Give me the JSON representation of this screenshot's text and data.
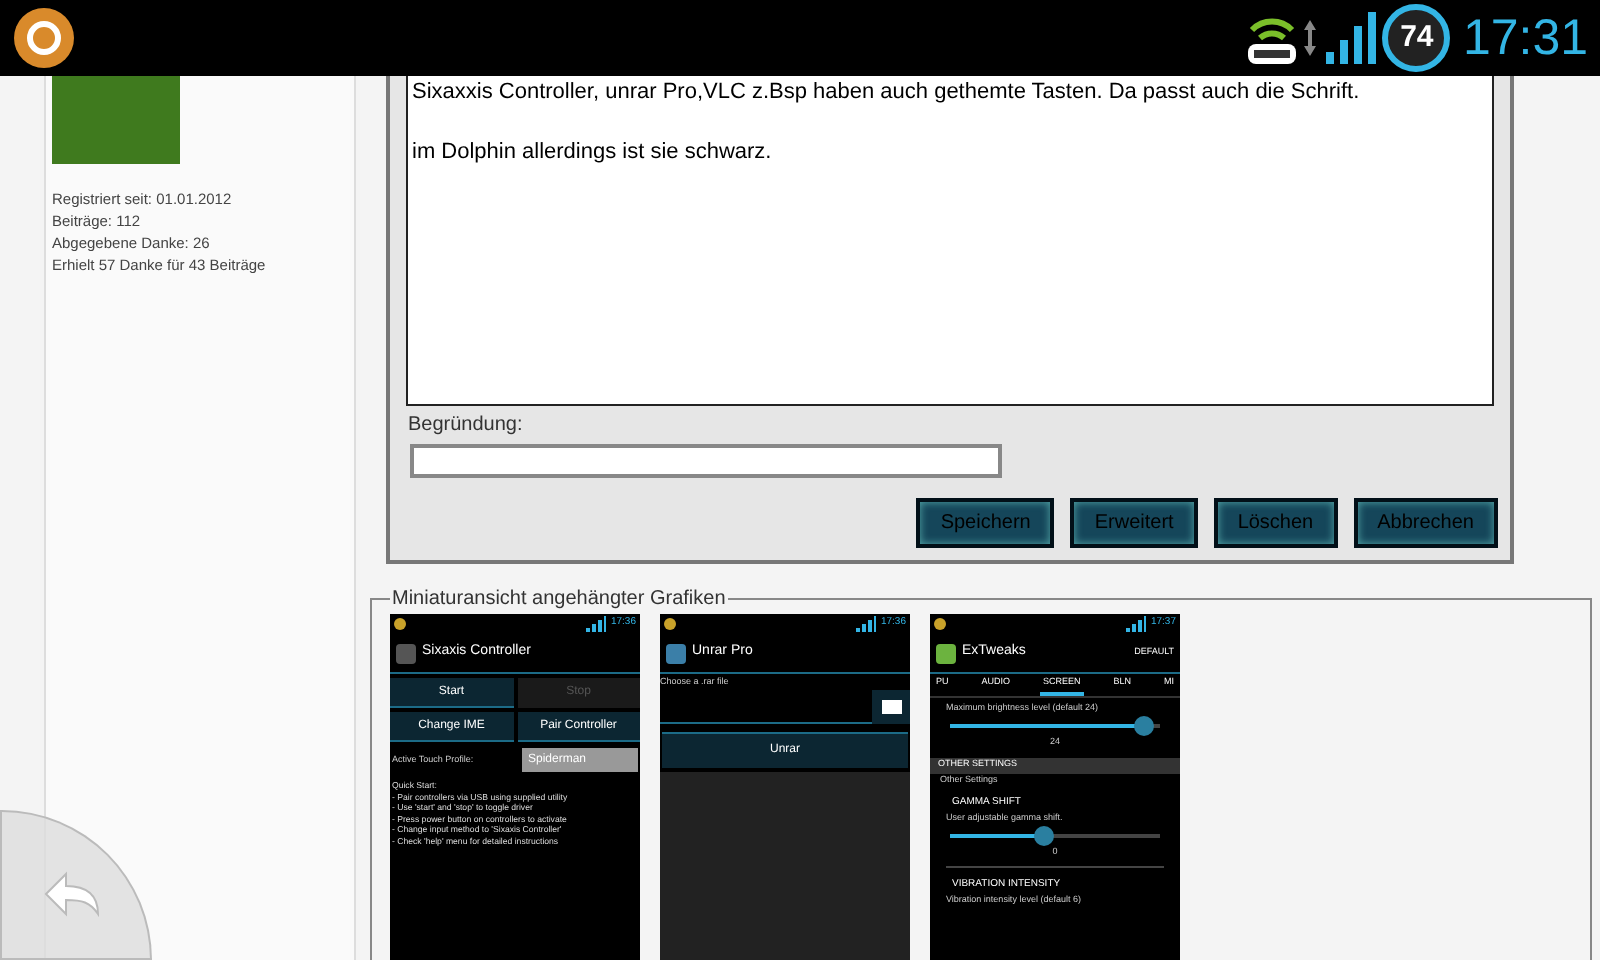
{
  "status_bar": {
    "battery": "74",
    "time": "17:31"
  },
  "profile": {
    "stats": [
      "Registriert seit: 01.01.2012",
      "Beiträge: 112",
      "Abgegebene Danke: 26",
      "Erhielt 57 Danke für 43 Beiträge"
    ]
  },
  "post": {
    "paragraphs": [
      "Sixaxxis Controller, unrar Pro,VLC z.Bsp haben auch gethemte Tasten. Da passt auch die Schrift.",
      "im Dolphin allerdings ist sie schwarz."
    ]
  },
  "edit_form": {
    "reason_label": "Begründung:",
    "buttons": [
      "Speichern",
      "Erweitert",
      "Löschen",
      "Abbrechen"
    ]
  },
  "attachments": {
    "legend": "Miniaturansicht angehängter Grafiken",
    "thumbnails": [
      {
        "kind": "sixaxis",
        "time": "17:36",
        "title": "Sixaxis Controller",
        "buttons": [
          {
            "label": "Start",
            "disabled": false
          },
          {
            "label": "Stop",
            "disabled": true
          },
          {
            "label": "Change IME",
            "disabled": false
          },
          {
            "label": "Pair Controller",
            "disabled": false
          }
        ],
        "profile_label": "Active Touch Profile:",
        "profile_value": "Spiderman",
        "quick_start": [
          "Quick Start:",
          "- Pair controllers via USB using supplied utility",
          "- Use 'start' and 'stop' to toggle driver",
          "- Press power button on controllers to activate",
          "- Change input method to 'Sixaxis Controller'",
          "- Check 'help' menu for detailed instructions"
        ]
      },
      {
        "kind": "unrar",
        "time": "17:36",
        "title": "Unrar Pro",
        "field_label": "Choose a .rar file",
        "button": "Unrar"
      },
      {
        "kind": "extweaks",
        "time": "17:37",
        "title": "ExTweaks",
        "action": "DEFAULT",
        "tabs": [
          {
            "label": "PU",
            "selected": false
          },
          {
            "label": "AUDIO",
            "selected": false
          },
          {
            "label": "SCREEN",
            "selected": true
          },
          {
            "label": "BLN",
            "selected": false
          },
          {
            "label": "MI",
            "selected": false
          }
        ],
        "brightness": {
          "label": "Maximum brightness level (default 24)",
          "level": 0.92,
          "reading": "24"
        },
        "section": "OTHER SETTINGS",
        "section_sub": "Other Settings",
        "gamma": {
          "title": "GAMMA SHIFT",
          "label": "User adjustable gamma shift.",
          "level": 0.45,
          "reading": "0"
        },
        "vibration": {
          "title": "VIBRATION INTENSITY",
          "label": "Vibration intensity level (default 6)"
        }
      }
    ]
  }
}
